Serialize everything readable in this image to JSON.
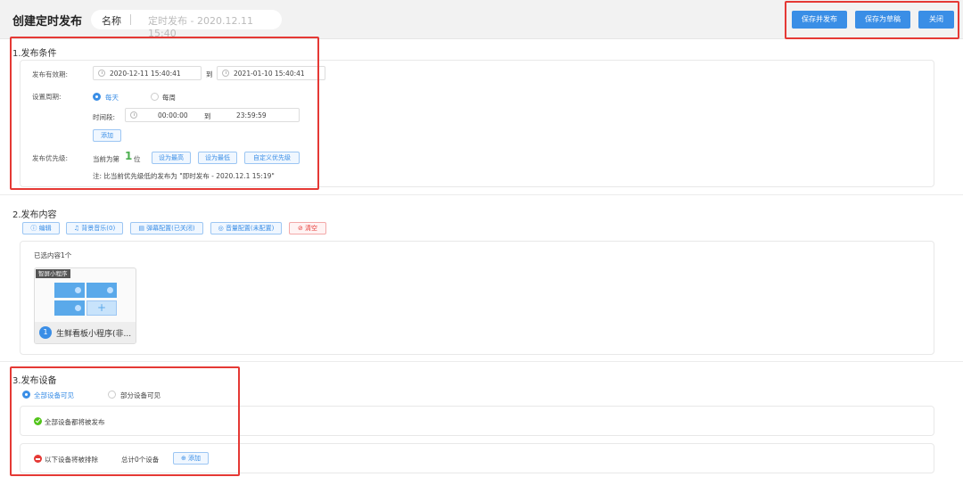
{
  "header": {
    "title": "创建定时发布",
    "name_label": "名称",
    "name_placeholder": "定时发布 - 2020.12.11 15:40",
    "save_publish": "保存并发布",
    "save_draft": "保存为草稿",
    "close": "关闭"
  },
  "section1": {
    "title": "1.发布条件",
    "validity_label": "发布有效期:",
    "start": "2020-12-11 15:40:41",
    "to": "到",
    "end": "2021-01-10 15:40:41",
    "period_label": "设置周期:",
    "daily": "每天",
    "weekly": "每周",
    "time_range_label": "时间段:",
    "time_start": "00:00:00",
    "time_end": "23:59:59",
    "add": "添加",
    "priority_label": "发布优先级:",
    "priority_prefix": "当前为第",
    "priority_value": "1",
    "priority_suffix": "位",
    "set_highest": "设为最高",
    "set_lowest": "设为最低",
    "custom_priority": "自定义优先级",
    "note": "注:   比当前优先级低的发布为 \"即时发布 - 2020.12.1 15:19\""
  },
  "section2": {
    "title": "2.发布内容",
    "edit": "编辑",
    "bg_music": "背景音乐(0)",
    "danmaku": "弹幕配置(已关闭)",
    "audio": "音量配置(未配置)",
    "clear": "清空",
    "selected": "已选内容1个",
    "card_tag": "智屏小程序",
    "card_index": "1",
    "card_name": "生鲜看板小程序(非..."
  },
  "section3": {
    "title": "3.发布设备",
    "all_visible": "全部设备可见",
    "partial_visible": "部分设备可见",
    "all_publish": "全部设备都将被发布",
    "excluded": "以下设备将被排除",
    "total": "总计0个设备",
    "add": "添加"
  }
}
